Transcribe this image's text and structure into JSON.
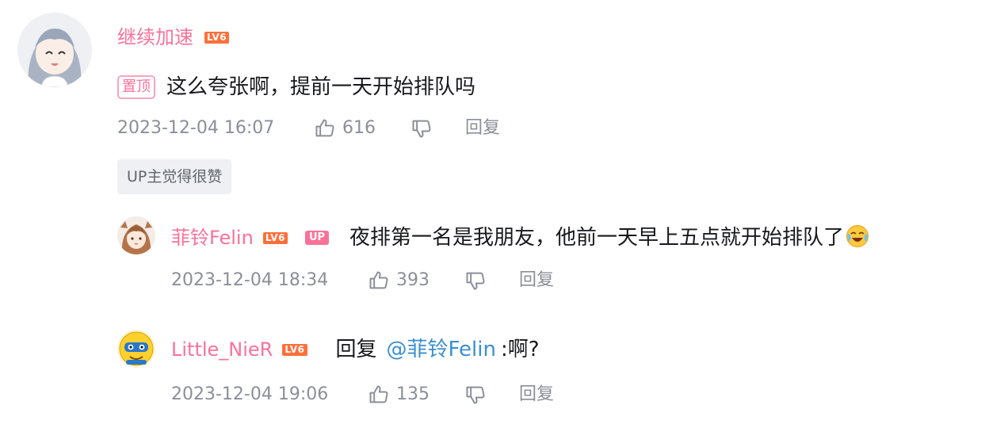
{
  "comments": [
    {
      "username": "继续加速",
      "level": "LV6",
      "pin_label": "置顶",
      "content": "这么夸张啊，提前一天开始排队吗",
      "time": "2023-12-04 16:07",
      "likes": "616",
      "reply_label": "回复",
      "up_liked_label": "UP主觉得很赞"
    },
    {
      "username": "菲铃Felin",
      "level": "LV6",
      "up_badge": "UP",
      "content": "夜排第一名是我朋友，他前一天早上五点就开始排队了",
      "time": "2023-12-04 18:34",
      "likes": "393",
      "reply_label": "回复"
    },
    {
      "username": "Little_NieR",
      "level": "LV6",
      "reply_prefix": "回复",
      "mention": "@菲铃Felin",
      "content": ":啊?",
      "time": "2023-12-04 19:06",
      "likes": "135",
      "reply_label": "回复"
    }
  ],
  "colors": {
    "username": "#fb7299",
    "level_badge": "#ff6f3a",
    "mention": "#3b8fd1",
    "meta": "#8a8f99"
  },
  "icons": {
    "like": "thumbs-up-icon",
    "dislike": "thumbs-down-icon",
    "emoji": "laughing-crying-emoji-icon"
  }
}
